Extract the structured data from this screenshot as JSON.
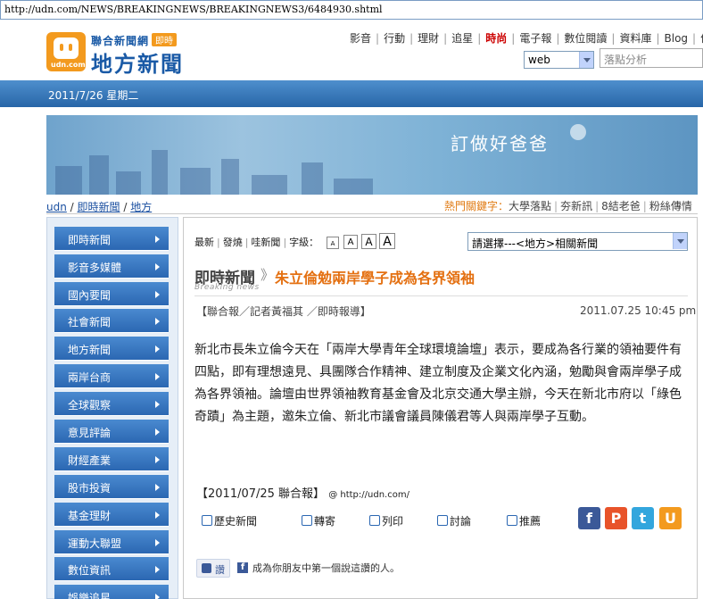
{
  "browser": {
    "url": "http://udn.com/NEWS/BREAKINGNEWS/BREAKINGNEWS3/6484930.shtml"
  },
  "header": {
    "logo_top": "聯合新聞網",
    "logo_badge": "即時",
    "logo_main": "地方新聞",
    "logo_domain": "udn.com",
    "nav": [
      "影音",
      "行動",
      "理財",
      "追星",
      "時尚",
      "電子報",
      "數位閱讀",
      "資料庫",
      "Blog",
      "便利"
    ],
    "search_type": "web",
    "search_placeholder": "落點分析"
  },
  "date": "2011/7/26 星期二",
  "banner_text": "訂做好爸爸",
  "breadcrumb": [
    "udn",
    "即時新聞",
    "地方"
  ],
  "hot_keywords": {
    "label": "熱門關鍵字：",
    "items": [
      "大學落點",
      "夯新訊",
      "8結老爸",
      "粉絲傳情"
    ]
  },
  "sidebar": [
    "即時新聞",
    "影音多媒體",
    "國內要聞",
    "社會新聞",
    "地方新聞",
    "兩岸台商",
    "全球觀察",
    "意見評論",
    "財經產業",
    "股市投資",
    "基金理財",
    "運動大聯盟",
    "數位資訊",
    "娛樂追星"
  ],
  "tools": {
    "links": [
      "最新",
      "發燒",
      "哇新聞"
    ],
    "font_label": "字級：",
    "font_sizes": [
      "A",
      "A",
      "A",
      "A"
    ]
  },
  "related_select": "請選擇---<地方>相關新聞",
  "article": {
    "section": "即時新聞",
    "section_en": "Breaking news",
    "arrow": "》",
    "headline": "朱立倫勉兩岸學子成為各界領袖",
    "byline": "【聯合報／記者黃福其 ／即時報導】",
    "datetime": "2011.07.25 10:45 pm",
    "body": "新北市長朱立倫今天在「兩岸大學青年全球環境論壇」表示，要成為各行業的領袖要件有四點，即有理想遠見、具團隊合作精神、建立制度及企業文化內涵，勉勵與會兩岸學子成為各界領袖。論壇由世界領袖教育基金會及北京交通大學主辦，今天在新北市府以「綠色奇蹟」為主題，邀朱立倫、新北市議會議員陳儀君等人與兩岸學子互動。",
    "source": "【2011/07/25 聯合報】",
    "source_at": "@ http://udn.com/"
  },
  "actions": [
    "歷史新聞",
    "轉寄",
    "列印",
    "討論",
    "推薦"
  ],
  "facebook": {
    "like": "讚",
    "text": "成為你朋友中第一個說這讚的人。"
  },
  "colors": {
    "accent_blue": "#2b67b2",
    "headline_orange": "#e47011",
    "hot_red": "#cc0000"
  }
}
